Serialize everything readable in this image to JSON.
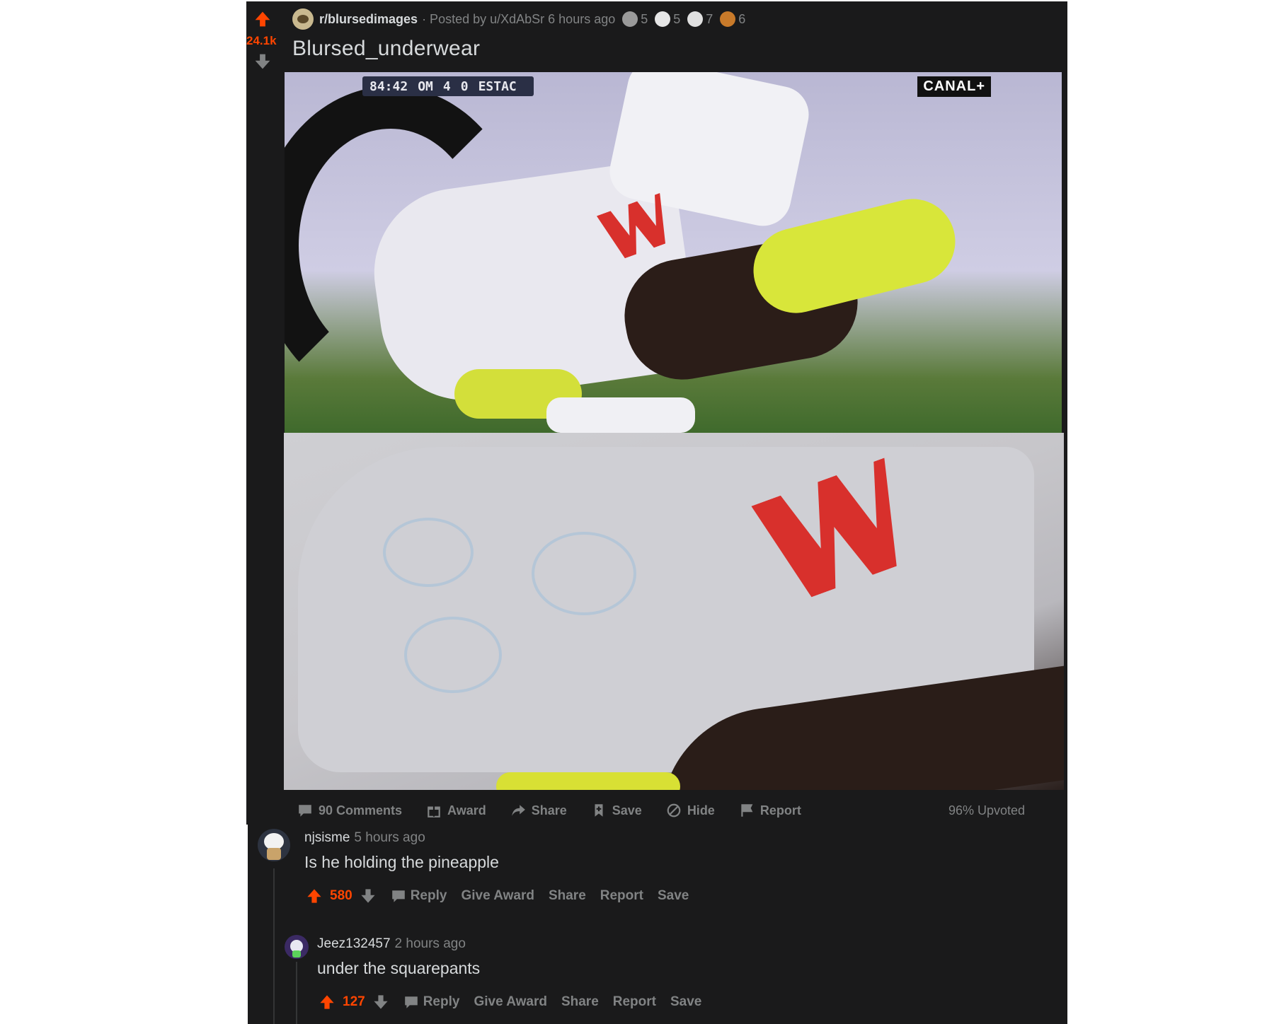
{
  "post": {
    "score": "24.1k",
    "subreddit": "r/blursedimages",
    "posted_by": "· Posted by u/XdAbSr 6 hours ago",
    "awards": [
      "5",
      "5",
      "7",
      "6"
    ],
    "title": "Blursed_underwear",
    "image": {
      "scoreboard_time": "84:42",
      "scoreboard_team1": "OM",
      "scoreboard_score": "4",
      "scoreboard_score2": "0",
      "scoreboard_team2": "ESTAC",
      "broadcaster": "CANAL+"
    },
    "actions": {
      "comments": "90 Comments",
      "award": "Award",
      "share": "Share",
      "save": "Save",
      "hide": "Hide",
      "report": "Report"
    },
    "upvoted": "96% Upvoted"
  },
  "comments": [
    {
      "user": "njsisme",
      "time": "5 hours ago",
      "body": "Is he holding the pineapple",
      "score": "580",
      "reply": "Reply",
      "give_award": "Give Award",
      "share": "Share",
      "report": "Report",
      "save": "Save"
    },
    {
      "user": "Jeez132457",
      "time": "2 hours ago",
      "body": "under the squarepants",
      "score": "127",
      "reply": "Reply",
      "give_award": "Give Award",
      "share": "Share",
      "report": "Report",
      "save": "Save"
    }
  ],
  "colors": {
    "background": "#1a1a1b",
    "accent_upvote": "#ff4500",
    "muted_text": "#818384",
    "text": "#d7dadc"
  }
}
